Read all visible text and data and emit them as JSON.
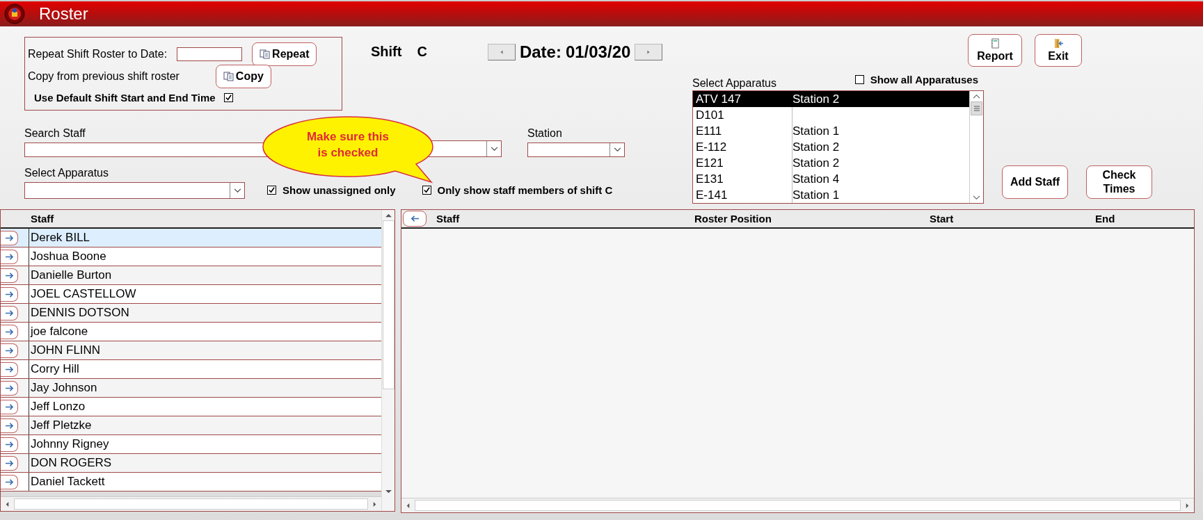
{
  "window": {
    "title": "Roster"
  },
  "copy_panel": {
    "repeat_label": "Repeat Shift Roster to Date:",
    "repeat_button": "Repeat",
    "copy_label": "Copy from previous shift roster",
    "copy_button": "Copy",
    "default_time": {
      "label": "Use Default Shift Start and End Time",
      "checked": true
    }
  },
  "shift": {
    "label": "Shift",
    "value": "C"
  },
  "date": {
    "label": "Date:",
    "value": "01/03/20"
  },
  "toolbar": [
    {
      "label": "Report",
      "kind": "report"
    },
    {
      "label": "Exit",
      "kind": "exit"
    }
  ],
  "filters": {
    "search_label": "Search Staff",
    "station_label": "Station",
    "apparatus_label": "Select Apparatus",
    "unassigned": {
      "label": "Show unassigned only",
      "checked": true
    },
    "shift_only": {
      "label": "Only show staff members of shift C",
      "checked": true
    }
  },
  "callout": {
    "text": "Make sure this is checked"
  },
  "apparatus_list": {
    "label": "Select Apparatus",
    "show_all": {
      "label": "Show all Apparatuses",
      "checked": false
    },
    "items": [
      {
        "name": "ATV 147",
        "station": "Station 2",
        "selected": true
      },
      {
        "name": "D101",
        "selected": false
      },
      {
        "name": "E111",
        "station": "Station 1",
        "selected": false
      },
      {
        "name": "E-112",
        "station": "Station 2",
        "selected": false
      },
      {
        "name": "E121",
        "station": "Station 2",
        "selected": false
      },
      {
        "name": "E131",
        "station": "Station 4",
        "selected": false
      },
      {
        "name": "E-141",
        "station": "Station 1",
        "selected": false
      }
    ]
  },
  "actions": [
    "Add Staff",
    "Check Times"
  ],
  "staff_table": {
    "columns": [
      "Staff"
    ],
    "rows": [
      {
        "name": "Derek BILL",
        "selected": true
      },
      {
        "name": "Joshua Boone",
        "selected": false
      },
      {
        "name": "Danielle Burton",
        "selected": false
      },
      {
        "name": "JOEL CASTELLOW",
        "selected": false
      },
      {
        "name": "DENNIS DOTSON",
        "selected": false
      },
      {
        "name": "joe falcone",
        "selected": false
      },
      {
        "name": "JOHN FLINN",
        "selected": false
      },
      {
        "name": "Corry Hill",
        "selected": false
      },
      {
        "name": "Jay Johnson",
        "selected": false
      },
      {
        "name": "Jeff Lonzo",
        "selected": false
      },
      {
        "name": "Jeff Pletzke",
        "selected": false
      },
      {
        "name": "Johnny Rigney",
        "selected": false
      },
      {
        "name": "DON ROGERS",
        "selected": false
      },
      {
        "name": "Daniel Tackett",
        "selected": false
      }
    ]
  },
  "roster_table": {
    "columns": [
      "Staff",
      "Roster Position",
      "Start",
      "End"
    ]
  }
}
